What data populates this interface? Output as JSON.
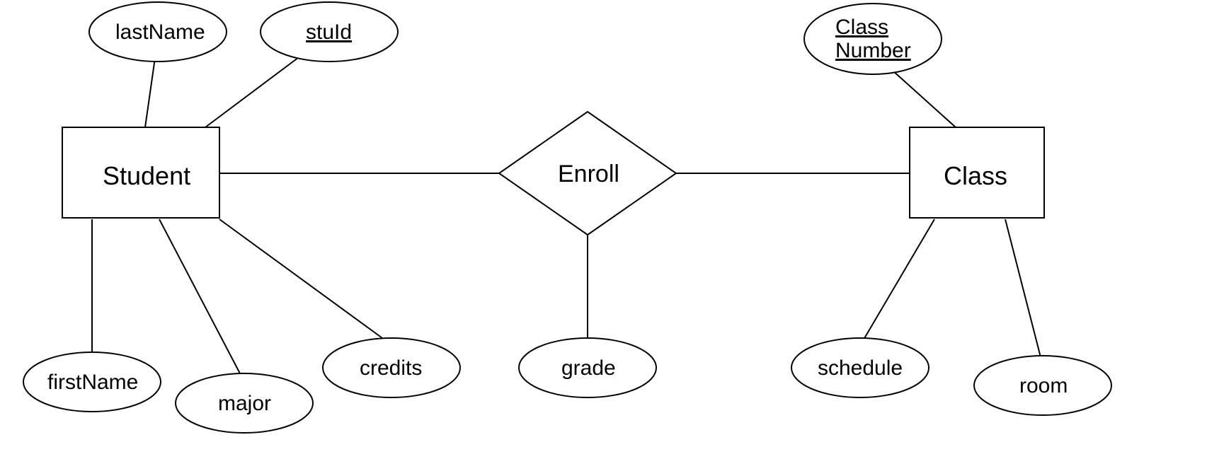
{
  "entities": {
    "student": {
      "name": "Student"
    },
    "class": {
      "name": "Class"
    }
  },
  "relationship": {
    "enroll": {
      "name": "Enroll"
    }
  },
  "attributes": {
    "lastName": {
      "label": "lastName",
      "isKey": false
    },
    "stuId": {
      "label": "stuId",
      "isKey": true
    },
    "firstName": {
      "label": "firstName",
      "isKey": false
    },
    "major": {
      "label": "major",
      "isKey": false
    },
    "credits": {
      "label": "credits",
      "isKey": false
    },
    "grade": {
      "label": "grade",
      "isKey": false
    },
    "classNumber": {
      "label": "Class Number",
      "isKey": true
    },
    "schedule": {
      "label": "schedule",
      "isKey": false
    },
    "room": {
      "label": "room",
      "isKey": false
    }
  }
}
